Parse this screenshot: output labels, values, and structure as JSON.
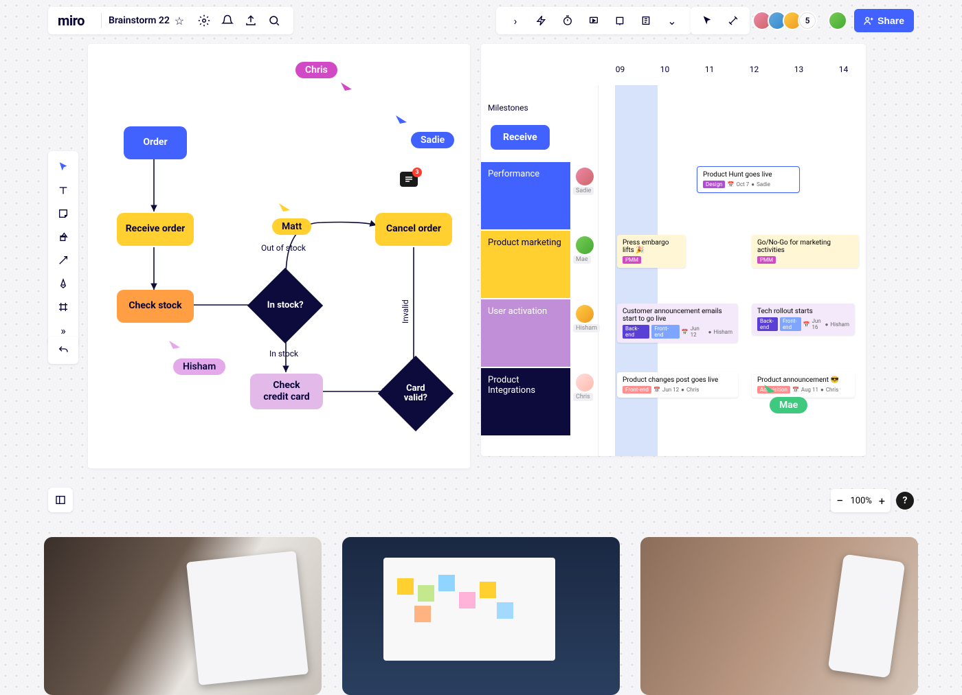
{
  "app": {
    "logo": "miro",
    "board_name": "Brainstorm 22"
  },
  "share_label": "Share",
  "collaborator_count": "5",
  "zoom": "100%",
  "cursors": {
    "chris": "Chris",
    "sadie": "Sadie",
    "matt": "Matt",
    "hisham": "Hisham",
    "mae": "Mae"
  },
  "comment_count": "3",
  "flow": {
    "order": "Order",
    "receive": "Receive order",
    "check_stock": "Check stock",
    "in_stock_q": "In stock?",
    "in_stock_label": "In stock",
    "out_of_stock_label": "Out of stock",
    "cancel": "Cancel order",
    "invalid_label": "Invalid",
    "check_card": "Check\ncredit card",
    "card_valid_q": "Card\nvalid?"
  },
  "timeline": {
    "dates": [
      "09",
      "10",
      "11",
      "12",
      "13",
      "14"
    ],
    "milestones_label": "Milestones",
    "milestone_pill": "Receive",
    "rows": [
      {
        "label": "Performance",
        "color": "#4262ff",
        "name": "Sadie"
      },
      {
        "label": "Product marketing",
        "color": "#ffd02f",
        "name": "Mae",
        "text_color": "#050038"
      },
      {
        "label": "User activation",
        "color": "#c08fd8",
        "name": "Hisham"
      },
      {
        "label": "Product Integrations",
        "color": "#0c0b3b",
        "name": "Chris"
      }
    ],
    "cards": {
      "ph_live": {
        "title": "Product Hunt goes live",
        "tag": "Design",
        "date": "Oct 7",
        "who": "Sadie"
      },
      "embargo": {
        "title": "Press embargo lifts 🎉",
        "tag": "PMM"
      },
      "gono": {
        "title": "Go/No-Go for marketing activities",
        "tag": "PMM"
      },
      "announce": {
        "title": "Customer announcement emails start to go live",
        "tag1": "Back-end",
        "tag2": "Front-end",
        "date": "Jun 12",
        "who": "Hisham"
      },
      "rollout": {
        "title": "Tech rollout starts",
        "tag1": "Back-end",
        "tag2": "Front-end",
        "date": "Jun 16",
        "who": "Hisham"
      },
      "changes": {
        "title": "Product changes post goes live",
        "tag": "Front-end",
        "date": "Jun 12",
        "who": "Chris"
      },
      "prod_ann": {
        "title": "Product announcement 😎",
        "tag": "Acquisition",
        "date": "Aug 11",
        "who": "Chris"
      }
    }
  }
}
